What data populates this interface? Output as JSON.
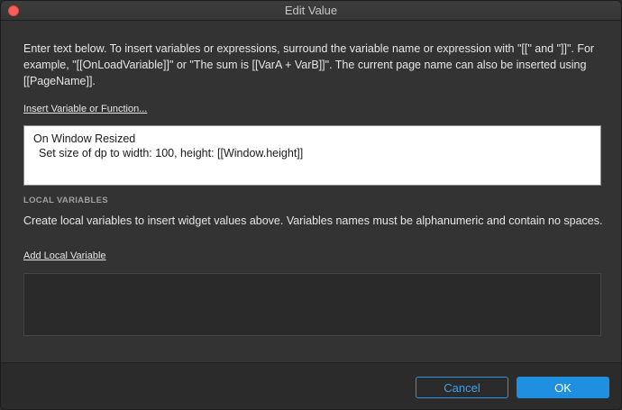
{
  "window": {
    "title": "Edit Value"
  },
  "intro_text": "Enter text below. To insert variables or expressions, surround the variable name or expression with \"[[\" and \"]]\". For example, \"[[OnLoadVariable]]\" or \"The sum is [[VarA + VarB]]\". The current page name can also be inserted using [[PageName]].",
  "insert_link": "Insert Variable or Function...",
  "editor": {
    "line1": "On Window Resized",
    "line2": "Set size of dp to width: 100, height: [[Window.height]]"
  },
  "local_variables": {
    "heading": "LOCAL VARIABLES",
    "description": "Create local variables to insert widget values above. Variables names must be alphanumeric and contain no spaces.",
    "add_link": "Add Local Variable"
  },
  "buttons": {
    "cancel": "Cancel",
    "ok": "OK"
  },
  "colors": {
    "accent": "#1f8fdf",
    "close": "#fd5e57"
  }
}
